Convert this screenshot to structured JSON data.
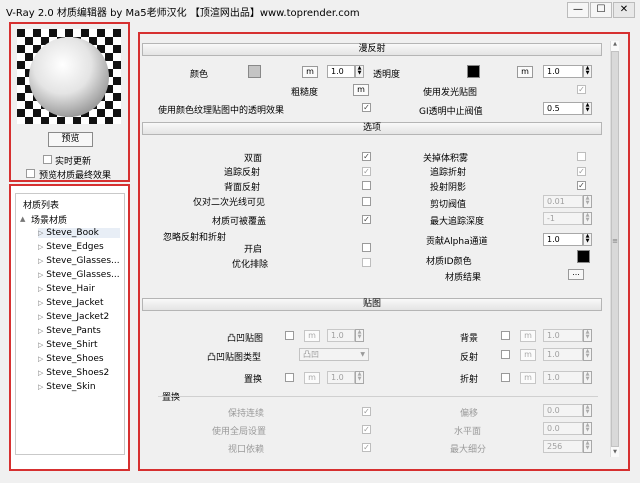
{
  "window": {
    "title": "V-Ray 2.0 材质编辑器 by Ma5老师汉化 【顶渲网出品】www.toprender.com",
    "min": "—",
    "max": "☐",
    "close": "✕"
  },
  "preview": {
    "button": "预览",
    "realtime": "实时更新",
    "final": "预览材质最终效果"
  },
  "tree": {
    "header": "材质列表",
    "root": "场景材质",
    "items": [
      "Steve_Book",
      "Steve_Edges",
      "Steve_Glasses...",
      "Steve_Glasses...",
      "Steve_Hair",
      "Steve_Jacket",
      "Steve_Jacket2",
      "Steve_Pants",
      "Steve_Shirt",
      "Steve_Shoes",
      "Steve_Shoes2",
      "Steve_Skin"
    ]
  },
  "diffuse": {
    "title": "漫反射",
    "color_label": "颜色",
    "color_swatch": "#c4c4c4",
    "m": "m",
    "color_amount": "1.0",
    "transparency_label": "透明度",
    "transparency_swatch": "#000000",
    "transparency_amount": "1.0",
    "roughness_label": "粗糙度",
    "use_emissive": "使用发光贴图",
    "use_alpha": "使用颜色纹理贴图中的透明效果",
    "gi_cutoff_label": "GI透明中止阀值",
    "gi_cutoff": "0.5"
  },
  "options": {
    "title": "选项",
    "double_sided": "双面",
    "trace_reflect": "追踪反射",
    "back_reflect": "背面反射",
    "secondary_only": "仅对二次光线可见",
    "overridable": "材质可被覆盖",
    "ignore_group": "忽略反射和折射",
    "on": "开启",
    "optimize": "优化排除",
    "closed_volume": "关掉体积雾",
    "trace_refract": "追踪折射",
    "cast_shadows": "投射阴影",
    "clip_label": "剪切阀值",
    "clip_value": "0.01",
    "max_depth_label": "最大追踪深度",
    "max_depth": "-1",
    "alpha_label": "贡献Alpha通道",
    "alpha_value": "1.0",
    "id_color_label": "材质ID颜色",
    "id_color": "#000000",
    "mat_result": "材质结果",
    "ellipsis": "..."
  },
  "maps": {
    "title": "贴图",
    "bump": "凸凹贴图",
    "bump_amount": "1.0",
    "bump_type_label": "凸凹贴图类型",
    "bump_type": "凸凹",
    "displace": "置换",
    "displace_amount": "1.0",
    "background": "背景",
    "bg_amount": "1.0",
    "reflection": "反射",
    "refl_amount": "1.0",
    "refraction": "折射",
    "refr_amount": "1.0",
    "m": "m"
  },
  "displacement": {
    "title": "置换",
    "keep_cont": "保持连续",
    "use_global": "使用全局设置",
    "view_dep": "视口依赖",
    "shift_label": "偏移",
    "shift": "0.0",
    "water_label": "水平面",
    "water": "0.0",
    "max_sub_label": "最大细分",
    "max_sub": "256"
  }
}
